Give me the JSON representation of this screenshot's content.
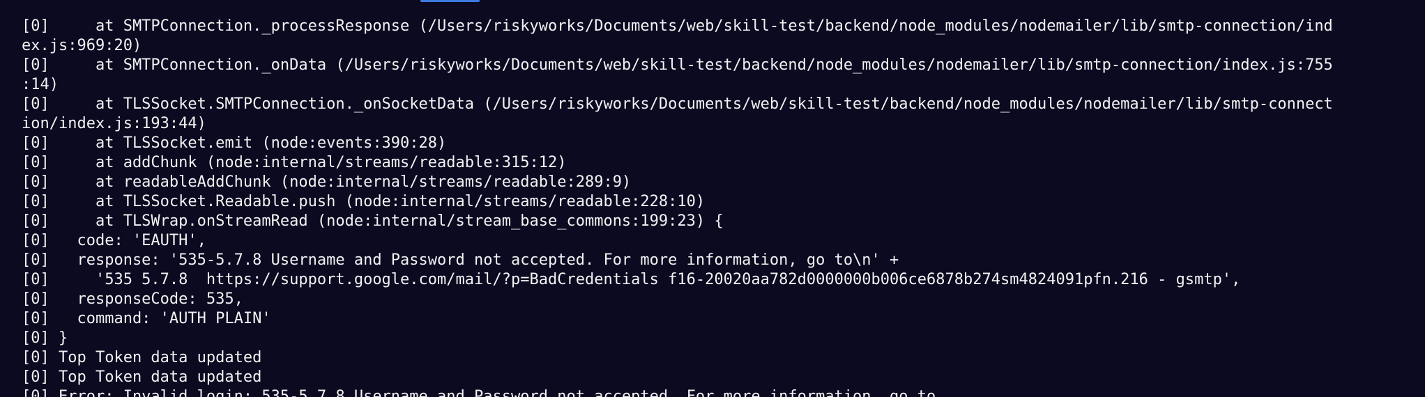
{
  "terminal": {
    "lines": [
      "[0]     at SMTPConnection._processResponse (/Users/riskyworks/Documents/web/skill-test/backend/node_modules/nodemailer/lib/smtp-connection/ind",
      "ex.js:969:20)",
      "[0]     at SMTPConnection._onData (/Users/riskyworks/Documents/web/skill-test/backend/node_modules/nodemailer/lib/smtp-connection/index.js:755",
      ":14)",
      "[0]     at TLSSocket.SMTPConnection._onSocketData (/Users/riskyworks/Documents/web/skill-test/backend/node_modules/nodemailer/lib/smtp-connect",
      "ion/index.js:193:44)",
      "[0]     at TLSSocket.emit (node:events:390:28)",
      "[0]     at addChunk (node:internal/streams/readable:315:12)",
      "[0]     at readableAddChunk (node:internal/streams/readable:289:9)",
      "[0]     at TLSSocket.Readable.push (node:internal/streams/readable:228:10)",
      "[0]     at TLSWrap.onStreamRead (node:internal/stream_base_commons:199:23) {",
      "[0]   code: 'EAUTH',",
      "[0]   response: '535-5.7.8 Username and Password not accepted. For more information, go to\\n' +",
      "[0]     '535 5.7.8  https://support.google.com/mail/?p=BadCredentials f16-20020aa782d0000000b006ce6878b274sm4824091pfn.216 - gsmtp',",
      "[0]   responseCode: 535,",
      "[0]   command: 'AUTH PLAIN'",
      "[0] }",
      "[0] Top Token data updated",
      "[0] Top Token data updated",
      "[0] Error: Invalid login: 535-5.7.8 Username and Password not accepted. For more information, go to"
    ]
  }
}
